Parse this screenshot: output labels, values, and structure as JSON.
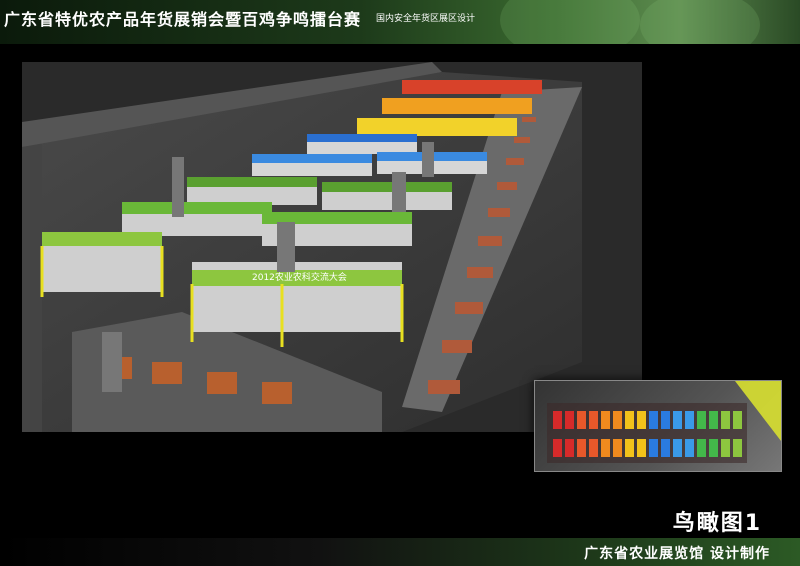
{
  "header": {
    "title": "广东省特优农产品年货展销会暨百鸡争鸣擂台赛",
    "subtitle": "国内安全年货区展区设计"
  },
  "rendering": {
    "banner_text": "2012农业农科交流大会"
  },
  "minimap": {
    "colors": [
      "#d62a2a",
      "#e8582a",
      "#f08a1e",
      "#f2c21a",
      "#2a7be0",
      "#3a9ae8",
      "#43b84a",
      "#8dc63f"
    ]
  },
  "view_caption": "鸟瞰图1",
  "footer": {
    "credit": "广东省农业展览馆  设计制作"
  }
}
